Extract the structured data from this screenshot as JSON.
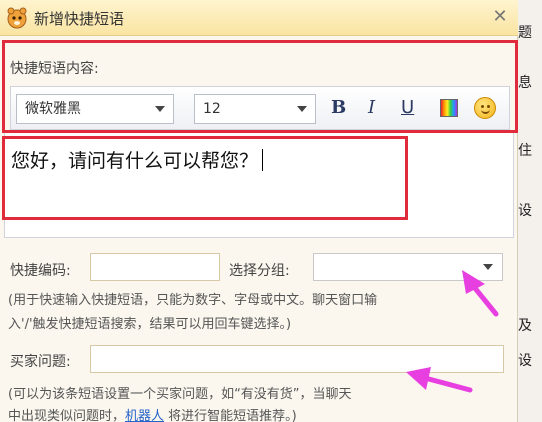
{
  "dialog": {
    "title": "新增快捷短语",
    "close_label": "✕"
  },
  "content_section": {
    "label": "快捷短语内容:"
  },
  "toolbar": {
    "font": "微软雅黑",
    "size": "12",
    "bold": "B",
    "italic": "I",
    "underline": "U",
    "color_icon": "color-palette-icon",
    "emoji_icon": "smiley-icon"
  },
  "editor": {
    "text": "您好，请问有什么可以帮您？"
  },
  "code_row": {
    "label": "快捷编码:",
    "value": "",
    "group_label": "选择分组:",
    "group_value": ""
  },
  "hints": {
    "line1": "(用于快速输入快捷短语，只能为数字、字母或中文。聊天窗口输",
    "line2": "入'/'触发快捷短语搜索，结果可以用回车键选择。)",
    "line3": "(可以为该条短语设置一个买家问题，如“有没有货”，当聊天",
    "line4_prefix": "中出现类似问题时，",
    "line4_link": "机器人",
    "line4_suffix": " 将进行智能短语推荐。)"
  },
  "buyer_row": {
    "label": "买家问题:",
    "value": ""
  },
  "background_fragments": [
    "题",
    "息",
    "住",
    "设",
    "及",
    "设"
  ],
  "colors": {
    "highlight_red": "#e02b3c",
    "annotation_arrow": "#e83fe0",
    "title_bar": "#f9e4a2",
    "link_blue": "#2563c9"
  }
}
